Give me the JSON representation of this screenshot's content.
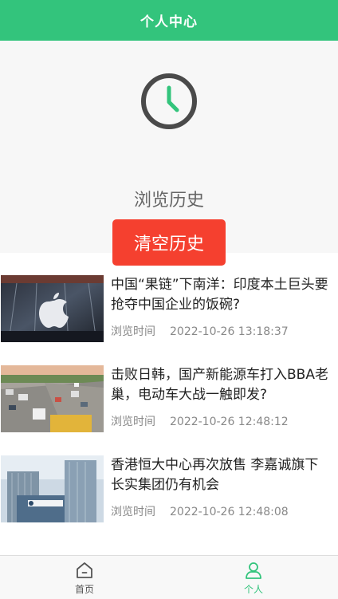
{
  "header": {
    "title": "个人中心"
  },
  "hero": {
    "icon": "clock-icon",
    "label": "浏览历史",
    "clear_button": "清空历史"
  },
  "news": [
    {
      "title": "中国“果链”下南洋：印度本土巨头要抢夺中国企业的饭碗?",
      "time_label": "浏览时间",
      "time": "2022-10-26 13:18:37"
    },
    {
      "title": "击败日韩，国产新能源车打入BBA老巢，电动车大战一触即发?",
      "time_label": "浏览时间",
      "time": "2022-10-26 12:48:12"
    },
    {
      "title": "香港恒大中心再次放售 李嘉诚旗下长实集团仍有机会",
      "time_label": "浏览时间",
      "time": "2022-10-26 12:48:08"
    }
  ],
  "tabbar": {
    "home_label": "首页",
    "me_label": "个人"
  },
  "colors": {
    "brand": "#33c47c",
    "danger": "#f5402f",
    "hero_bg": "#f7f7f7"
  }
}
